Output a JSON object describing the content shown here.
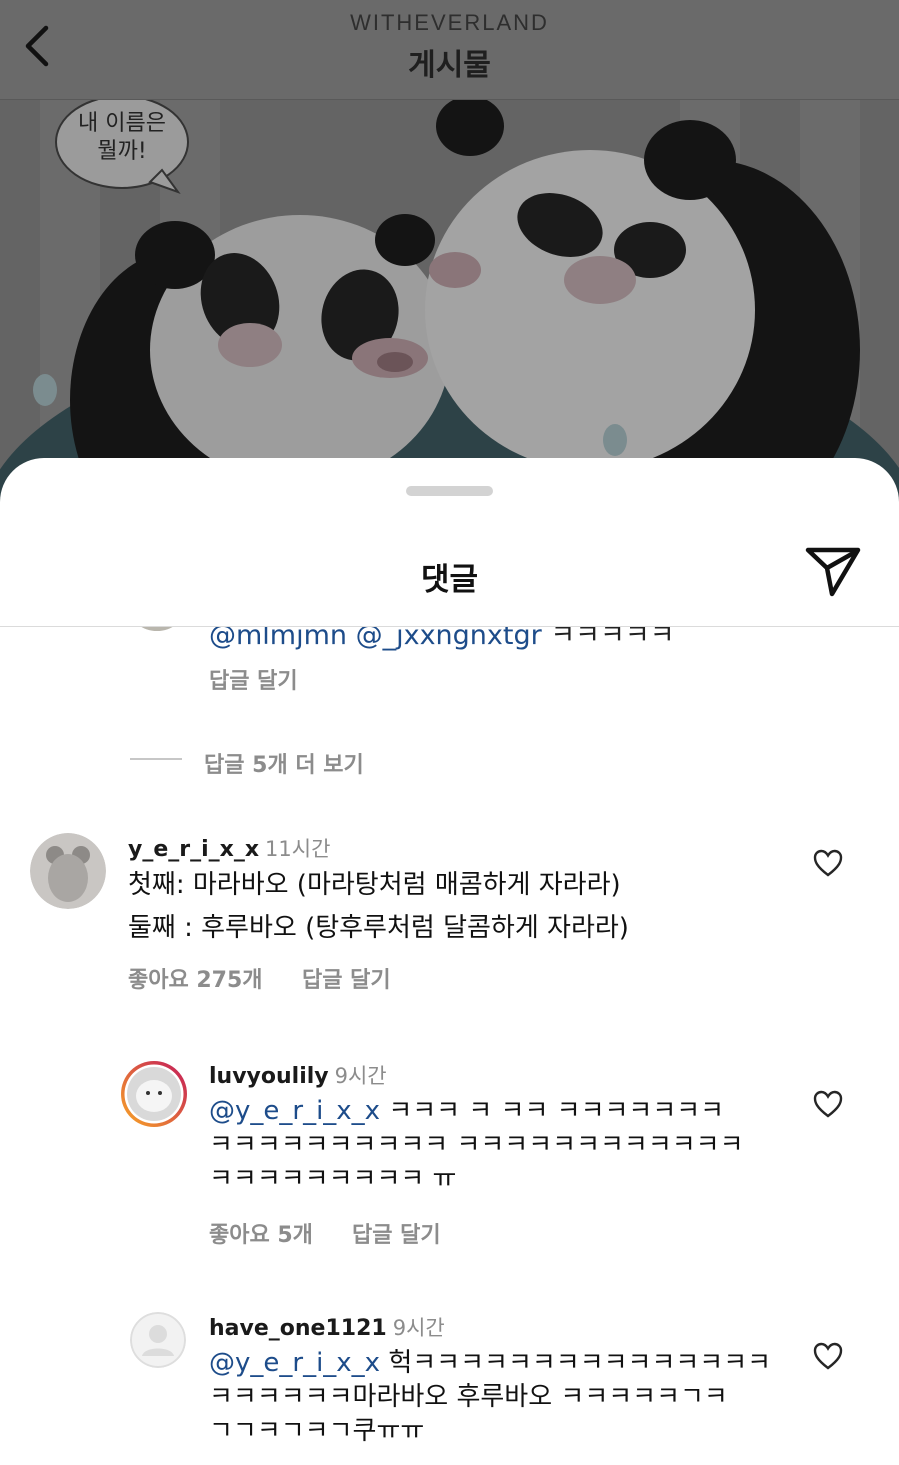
{
  "header": {
    "account_name": "WITHEVERLAND",
    "title": "게시물"
  },
  "post_image": {
    "bubble_line1": "내 이름은",
    "bubble_line2": "뭘까!"
  },
  "sheet": {
    "title": "댓글"
  },
  "partial_comment": {
    "text_mentions": "@mlmjmn @_jxxngnxtgr",
    "text_tail": "ㅋㅋㅋㅋㅋ",
    "reply_label": "답글 달기"
  },
  "more_replies_label": "답글 5개 더 보기",
  "comments": [
    {
      "username": "y_e_r_i_x_x",
      "time": "11시간",
      "lines": [
        "첫째: 마라바오 (마라탕처럼 매콤하게 자라라)",
        "둘째 : 후루바오 (탕후루처럼 달콤하게 자라라)"
      ],
      "likes": "좋아요 275개",
      "reply_label": "답글 달기"
    }
  ],
  "replies": [
    {
      "username": "luvyoulily",
      "time": "9시간",
      "mention": "@y_e_r_i_x_x",
      "line1_rest": " ㅋㅋㅋ ㅋ ㅋㅋ ㅋㅋㅋㅋㅋㅋㅋ",
      "line2": "ㅋㅋㅋㅋㅋㅋㅋㅋㅋㅋ ㅋㅋㅋㅋㅋㅋㅋㅋㅋㅋㅋㅋ",
      "line3": "ㅋㅋㅋㅋㅋㅋㅋㅋㅋ ㅠ",
      "likes": "좋아요 5개",
      "reply_label": "답글 달기"
    },
    {
      "username": "have_one1121",
      "time": "9시간",
      "mention": "@y_e_r_i_x_x",
      "line1_rest": " 헉ㅋㅋㅋㅋㅋㅋㅋㅋㅋㅋㅋㅋㅋㅋㅋ",
      "line2": "ㅋㅋㅋㅋㅋㅋ마라바오 후루바오 ㅋㅋㅋㅋㅋㄱㅋ",
      "line3": "ㄱㄱㅋㄱㅋㄱ쿠ㅠㅠ"
    }
  ],
  "colors": {
    "mention": "#1d4c8a",
    "secondary_text": "#8c8c8c",
    "story_ring_start": "#f9a825",
    "story_ring_end": "#c2185b"
  },
  "icons": [
    "back-chevron-icon",
    "send-icon",
    "heart-outline-icon"
  ]
}
